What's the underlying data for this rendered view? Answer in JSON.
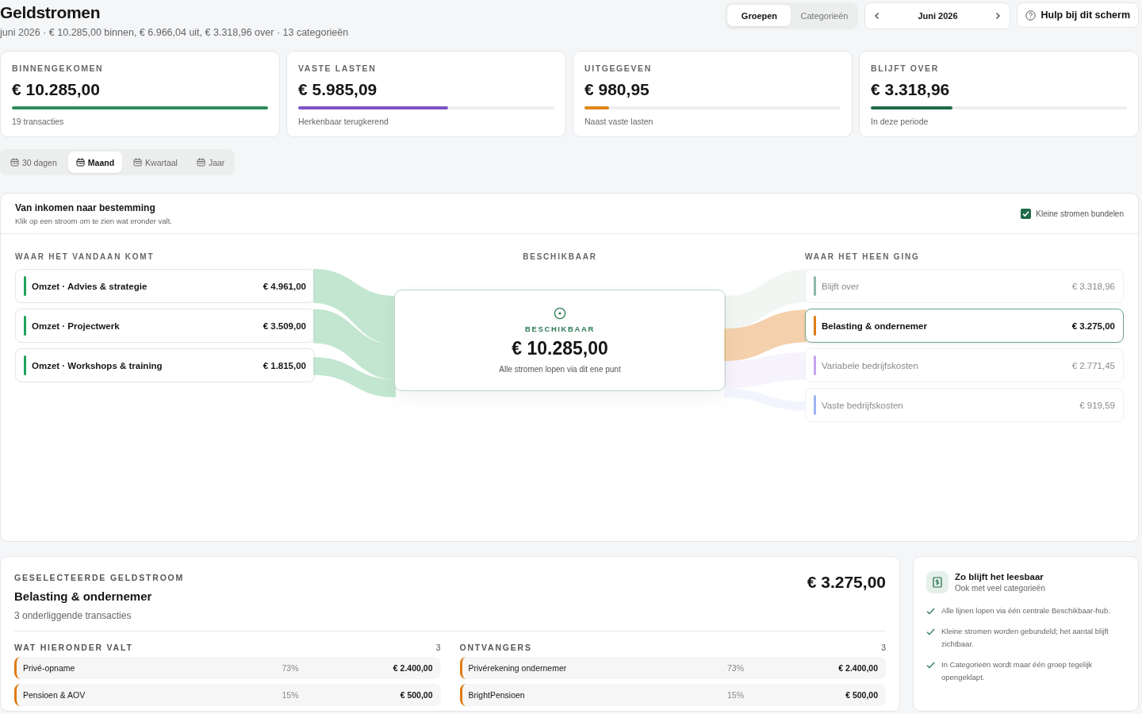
{
  "header": {
    "title": "Geldstromen",
    "summary": "juni 2026 · € 10.285,00 binnen, € 6.966,04 uit, € 3.318,96 over · 13 categorieën",
    "view_toggle": [
      {
        "label": "Groepen",
        "selected": true
      },
      {
        "label": "Categorieën",
        "selected": false
      }
    ],
    "month": "Juni 2026",
    "help_button": "Hulp bij dit scherm"
  },
  "stats": [
    {
      "label": "BINNENGEKOMEN",
      "amount": "€ 10.285,00",
      "level": 1,
      "color": "#2e8b5e",
      "note": "19 transacties"
    },
    {
      "label": "VASTE LASTEN",
      "amount": "€ 5.985,09",
      "level": 0.585,
      "color": "#7d55c7",
      "note": "Herkenbaar terugkerend"
    },
    {
      "label": "UITGEGEVEN",
      "amount": "€ 980,95",
      "level": 0.095,
      "color": "#e0861a",
      "note": "Naast vaste lasten"
    },
    {
      "label": "BLIJFT OVER",
      "amount": "€ 3.318,96",
      "level": 0.32,
      "color": "#1f6b4a",
      "note": "In deze periode"
    }
  ],
  "periods": [
    {
      "label": "30 dagen",
      "selected": false
    },
    {
      "label": "Maand",
      "selected": true
    },
    {
      "label": "Kwartaal",
      "selected": false
    },
    {
      "label": "Jaar",
      "selected": false
    }
  ],
  "flow_panel": {
    "title": "Van inkomen naar bestemming",
    "subtitle": "Klik op een stroom om te zien wat eronder valt.",
    "bundle_checkbox": {
      "label": "Kleine stromen bundelen",
      "checked": true
    },
    "sources_heading": "WAAR HET VANDAAN KOMT",
    "hub_heading": "BESCHIKBAAR",
    "destinations_heading": "WAAR HET HEEN GING",
    "sources": [
      {
        "name": "Omzet · Advies & strategie",
        "amount": "€ 4.961,00"
      },
      {
        "name": "Omzet · Projectwerk",
        "amount": "€ 3.509,00"
      },
      {
        "name": "Omzet · Workshops & training",
        "amount": "€ 1.815,00"
      }
    ],
    "hub": {
      "label": "BESCHIKBAAR",
      "amount": "€ 10.285,00",
      "note": "Alle stromen lopen via dit ene punt"
    },
    "destinations": [
      {
        "name": "Blijft over",
        "amount": "€ 3.318,96",
        "color": "#8fb8a6",
        "selected": false
      },
      {
        "name": "Belasting & ondernemer",
        "amount": "€ 3.275,00",
        "color": "#e07b12",
        "selected": true
      },
      {
        "name": "Variabele bedrijfskosten",
        "amount": "€ 2.771,45",
        "color": "#c4a4f0",
        "selected": false
      },
      {
        "name": "Vaste bedrijfskosten",
        "amount": "€ 919,59",
        "color": "#9db5f5",
        "selected": false
      }
    ]
  },
  "selected_flow": {
    "label": "GESELECTEERDE GELDSTROOM",
    "title": "Belasting & ondernemer",
    "subtitle": "3 onderliggende transacties",
    "amount": "€ 3.275,00",
    "lists": [
      {
        "heading": "WAT HIERONDER VALT",
        "count": "3",
        "rows": [
          {
            "name": "Privé-opname",
            "share": "73%",
            "amount": "€ 2.400,00"
          },
          {
            "name": "Pensioen & AOV",
            "share": "15%",
            "amount": "€ 500,00"
          }
        ]
      },
      {
        "heading": "ONTVANGERS",
        "count": "3",
        "rows": [
          {
            "name": "Privérekening ondernemer",
            "share": "73%",
            "amount": "€ 2.400,00"
          },
          {
            "name": "BrightPensioen",
            "share": "15%",
            "amount": "€ 500,00"
          }
        ]
      }
    ]
  },
  "tips": {
    "title": "Zo blijft het leesbaar",
    "subtitle": "Ook met veel categorieën",
    "items": [
      "Alle lijnen lopen via één centrale Beschikbaar-hub.",
      "Kleine stromen worden gebundeld; het aantal blijft zichtbaar.",
      "In Categorieën wordt maar één groep tegelijk opengeklapt."
    ]
  }
}
